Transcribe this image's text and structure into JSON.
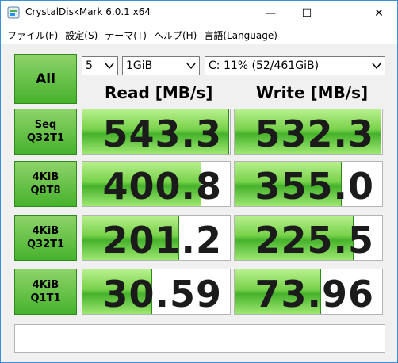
{
  "window": {
    "title": "CrystalDiskMark 6.0.1 x64",
    "minimize_glyph": "—",
    "maximize_glyph": "☐",
    "close_glyph": "✕"
  },
  "menu": [
    {
      "label": "ファイル(F)"
    },
    {
      "label": "設定(S)"
    },
    {
      "label": "テーマ(T)"
    },
    {
      "label": "ヘルプ(H)"
    },
    {
      "label": "言語(Language)"
    }
  ],
  "controls": {
    "all_label": "All",
    "test_count": "5",
    "test_size": "1GiB",
    "drive": "C: 11% (52/461GiB)"
  },
  "headers": {
    "read": "Read [MB/s]",
    "write": "Write [MB/s]"
  },
  "rows": [
    {
      "line1": "Seq",
      "line2": "Q32T1",
      "read": "543.3",
      "write": "532.3",
      "read_fill": 0.99,
      "write_fill": 0.99
    },
    {
      "line1": "4KiB",
      "line2": "Q8T8",
      "read": "400.8",
      "write": "355.0",
      "read_fill": 0.8,
      "write_fill": 0.72
    },
    {
      "line1": "4KiB",
      "line2": "Q32T1",
      "read": "201.2",
      "write": "225.5",
      "read_fill": 0.65,
      "write_fill": 0.8
    },
    {
      "line1": "4KiB",
      "line2": "Q1T1",
      "read": "30.59",
      "write": "73.96",
      "read_fill": 0.47,
      "write_fill": 0.58
    }
  ],
  "colors": {
    "accent_green": "#46b22c",
    "window_border": "#3c8fd6"
  }
}
